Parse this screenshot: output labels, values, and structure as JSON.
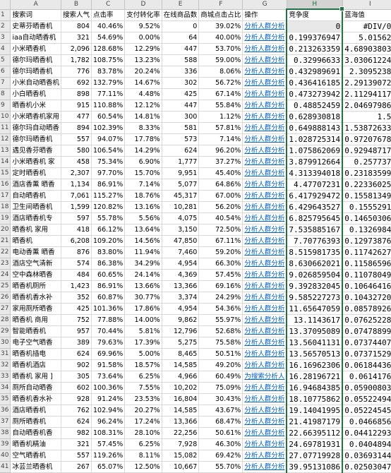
{
  "columns": [
    "",
    "A",
    "B",
    "C",
    "D",
    "E",
    "F",
    "G",
    "H",
    "I"
  ],
  "header": [
    "搜索词",
    "搜索人气",
    "点击率",
    "支付转化率",
    "在线商品数",
    "商城点击占比",
    "操作",
    "竞争度",
    "蓝海值"
  ],
  "rows": [
    {
      "n": "2",
      "a": "史蒂芬晒香机",
      "b": "804",
      "c": "40.46%",
      "d": "9.52%",
      "e": "0",
      "f": "39.02%",
      "g": "分析人群分析",
      "h": "0",
      "i": "#DIV/0!"
    },
    {
      "n": "3",
      "a": "iaa自动晒香机",
      "b": "321",
      "c": "54.69%",
      "d": "0.00%",
      "e": "64",
      "f": "40.00%",
      "g": "分析人群分析",
      "h": "0.199376947",
      "i": "5.015625"
    },
    {
      "n": "4",
      "a": "小米晒香机",
      "b": "2,096",
      "c": "128.68%",
      "d": "12.29%",
      "e": "447",
      "f": "53.70%",
      "g": "分析人群分析",
      "h": "0.213263359",
      "i": "4.689038031"
    },
    {
      "n": "5",
      "a": "德尔玛晒香机",
      "b": "1,782",
      "c": "108.75%",
      "d": "13.23%",
      "e": "588",
      "f": "59.00%",
      "g": "分析人群分析",
      "h": "0.32996633",
      "i": "3.030612245"
    },
    {
      "n": "6",
      "a": "德尔玛晒香机",
      "b": "776",
      "c": "83.78%",
      "d": "20.24%",
      "e": "336",
      "f": "8.06%",
      "g": "分析人群分析",
      "h": "0.432989691",
      "i": "2.30952381"
    },
    {
      "n": "7",
      "a": "小米自动晒香机",
      "b": "692",
      "c": "132.79%",
      "d": "14.67%",
      "e": "302",
      "f": "56.72%",
      "g": "分析人群分析",
      "h": "0.436416185",
      "i": "2.291390728"
    },
    {
      "n": "8",
      "a": "小白晒香机",
      "b": "898",
      "c": "77.11%",
      "d": "4.48%",
      "e": "425",
      "f": "67.14%",
      "g": "分析人群分析",
      "h": "0.473273942",
      "i": "2.112941176"
    },
    {
      "n": "9",
      "a": "晒香机小米",
      "b": "915",
      "c": "110.88%",
      "d": "12.12%",
      "e": "447",
      "f": "55.84%",
      "g": "分析人群分析",
      "h": "0.48852459",
      "i": "2.046979866"
    },
    {
      "n": "10",
      "a": "小米晒香机家用",
      "b": "477",
      "c": "60.54%",
      "d": "14.81%",
      "e": "300",
      "f": "1.12%",
      "g": "分析人群分析",
      "h": "0.628930818",
      "i": "1.59"
    },
    {
      "n": "11",
      "a": "德尔玛自动晒香",
      "b": "894",
      "c": "102.39%",
      "d": "8.33%",
      "e": "581",
      "f": "57.81%",
      "g": "分析人群分析",
      "h": "0.649888143",
      "i": "1.538726334"
    },
    {
      "n": "12",
      "a": "德尔玛晒香机",
      "b": "557",
      "c": "94.07%",
      "d": "17.78%",
      "e": "573",
      "f": "7.14%",
      "g": "分析人群分析",
      "h": "1.028725314",
      "i": "0.972076789"
    },
    {
      "n": "13",
      "a": "遇见香芬晒香",
      "b": "580",
      "c": "106.54%",
      "d": "14.29%",
      "e": "624",
      "f": "96.20%",
      "g": "分析人群分析",
      "h": "1.075862069",
      "i": "0.929487179"
    },
    {
      "n": "14",
      "a": "小米晒香机 家",
      "b": "458",
      "c": "75.34%",
      "d": "6.90%",
      "e": "1,777",
      "f": "37.27%",
      "g": "分析人群分析",
      "h": "3.879912664",
      "i": "0.2577376"
    },
    {
      "n": "15",
      "a": "定时晒香机",
      "b": "2,307",
      "c": "97.70%",
      "d": "15.70%",
      "e": "9,951",
      "f": "45.40%",
      "g": "分析人群分析",
      "h": "4.313394018",
      "i": "0.231835996"
    },
    {
      "n": "16",
      "a": "酒店香薰 晒香",
      "b": "1,134",
      "c": "86.91%",
      "d": "7.14%",
      "e": "5,077",
      "f": "64.86%",
      "g": "分析人群分析",
      "h": "4.47707231",
      "i": "0.223360252"
    },
    {
      "n": "17",
      "a": "自动晒香机",
      "b": "7,061",
      "c": "115.27%",
      "d": "18.76%",
      "e": "45,317",
      "f": "67.00%",
      "g": "分析人群分析",
      "h": "6.417929472",
      "i": "0.155813492"
    },
    {
      "n": "18",
      "a": "卫生间晒香机",
      "b": "1,599",
      "c": "120.82%",
      "d": "13.16%",
      "e": "10,281",
      "f": "56.20%",
      "g": "分析人群分析",
      "h": "6.429643527",
      "i": "0.15552918"
    },
    {
      "n": "19",
      "a": "酒店晒香机专",
      "b": "597",
      "c": "55.78%",
      "d": "5.56%",
      "e": "4,075",
      "f": "40.54%",
      "g": "分析人群分析",
      "h": "6.825795645",
      "i": "0.146503067"
    },
    {
      "n": "20",
      "a": "晒香机 家用",
      "b": "418",
      "c": "66.12%",
      "d": "13.64%",
      "e": "3,150",
      "f": "72.50%",
      "g": "分析人群分析",
      "h": "7.535885167",
      "i": "0.13269841"
    },
    {
      "n": "21",
      "a": "晒香机",
      "b": "6,208",
      "c": "109.20%",
      "d": "14.56%",
      "e": "47,850",
      "f": "67.11%",
      "g": "分析人群分析",
      "h": "7.70776393",
      "i": "0.129738767"
    },
    {
      "n": "22",
      "a": "电动香薰 晒香",
      "b": "876",
      "c": "83.80%",
      "d": "11.94%",
      "e": "7,460",
      "f": "59.20%",
      "g": "分析人群分析",
      "h": "8.515981735",
      "i": "0.117426273"
    },
    {
      "n": "23",
      "a": "酒店空气清新",
      "b": "574",
      "c": "86.38%",
      "d": "34.29%",
      "e": "4,954",
      "f": "66.30%",
      "g": "分析人群分析",
      "h": "8.630662021",
      "i": "0.115865967"
    },
    {
      "n": "24",
      "a": "空中森林晒香",
      "b": "484",
      "c": "60.65%",
      "d": "24.14%",
      "e": "4,369",
      "f": "57.45%",
      "g": "分析人群分析",
      "h": "9.026859504",
      "i": "0.110780499"
    },
    {
      "n": "25",
      "a": "晒香机厕所",
      "b": "1,423",
      "c": "86.91%",
      "d": "13.66%",
      "e": "13,366",
      "f": "69.16%",
      "g": "分析人群分析",
      "h": "9.392832045",
      "i": "0.106464163"
    },
    {
      "n": "26",
      "a": "晒香机香水补",
      "b": "352",
      "c": "60.87%",
      "d": "30.77%",
      "e": "3,374",
      "f": "24.29%",
      "g": "分析人群分析",
      "h": "9.585227273",
      "i": "0.104327208"
    },
    {
      "n": "27",
      "a": "家用厕所晒香",
      "b": "425",
      "c": "101.36%",
      "d": "17.86%",
      "e": "4,954",
      "f": "54.36%",
      "g": "分析人群分析",
      "h": "11.65647059",
      "i": "0.085789261"
    },
    {
      "n": "28",
      "a": "晒香机 商用",
      "b": "752",
      "c": "77.88%",
      "d": "14.00%",
      "e": "9,862",
      "f": "55.97%",
      "g": "分析人群分析",
      "h": "13.1143617",
      "i": "0.076252281"
    },
    {
      "n": "29",
      "a": "智能晒香机",
      "b": "957",
      "c": "70.44%",
      "d": "5.81%",
      "e": "12,796",
      "f": "52.68%",
      "g": "分析人群分析",
      "h": "13.37095089",
      "i": "0.074788997"
    },
    {
      "n": "30",
      "a": "电子空气晒香",
      "b": "389",
      "c": "79.63%",
      "d": "17.39%",
      "e": "5,275",
      "f": "75.58%",
      "g": "分析人群分析",
      "h": "13.56041131",
      "i": "0.073744076"
    },
    {
      "n": "31",
      "a": "晒香机插电",
      "b": "624",
      "c": "69.96%",
      "d": "5.00%",
      "e": "8,465",
      "f": "50.51%",
      "g": "分析人群分析",
      "h": "13.56570513",
      "i": "0.073715298"
    },
    {
      "n": "32",
      "a": "晒香机酒店",
      "b": "902",
      "c": "91.58%",
      "d": "18.57%",
      "e": "14,585",
      "f": "49.20%",
      "g": "分析人群分析",
      "h": "16.16962306",
      "i": "0.061844361"
    },
    {
      "n": "33",
      "a": "晒香机 家用 ]",
      "b": "305",
      "c": "73.64%",
      "d": "6.25%",
      "e": "4,966",
      "f": "60.49%",
      "g": "为搜索分析人",
      "h": "16.28196721",
      "i": "0.06141764"
    },
    {
      "n": "34",
      "a": "厕所自动晒香",
      "b": "602",
      "c": "100.36%",
      "d": "7.55%",
      "e": "10,202",
      "f": "75.09%",
      "g": "分析人群分析",
      "h": "16.94684385",
      "i": "0.059008038"
    },
    {
      "n": "35",
      "a": "晒香机香水补",
      "b": "928",
      "c": "91.24%",
      "d": "23.53%",
      "e": "16,804",
      "f": "30.43%",
      "g": "分析人群分析",
      "h": "18.10775862",
      "i": "0.055224946"
    },
    {
      "n": "36",
      "a": "酒店晒香机",
      "b": "762",
      "c": "102.94%",
      "d": "20.27%",
      "e": "14,585",
      "f": "43.67%",
      "g": "分析人群分析",
      "h": "19.14041995",
      "i": "0.052245458"
    },
    {
      "n": "37",
      "a": "厕所晒香机",
      "b": "624",
      "c": "96.24%",
      "d": "17.24%",
      "e": "13,366",
      "f": "68.47%",
      "g": "分析人群分析",
      "h": "21.41987179",
      "i": "0.04668562"
    },
    {
      "n": "38",
      "a": "自动晒香机香",
      "b": "982",
      "c": "108.31%",
      "d": "28.10%",
      "e": "22,256",
      "f": "50.61%",
      "g": "分析人群分析",
      "h": "22.66395112",
      "i": "0.044122933"
    },
    {
      "n": "39",
      "a": "晒香机精油",
      "b": "321",
      "c": "57.45%",
      "d": "6.25%",
      "e": "7,928",
      "f": "46.30%",
      "g": "分析人群分析",
      "h": "24.69781931",
      "i": "0.04048945"
    },
    {
      "n": "40",
      "a": "空气晒香机",
      "b": "557",
      "c": "119.26%",
      "d": "8.11%",
      "e": "15,082",
      "f": "69.42%",
      "g": "分析人群分析",
      "h": "27.07719928",
      "i": "0.036931441"
    },
    {
      "n": "41",
      "a": "冰芸兰晒香机",
      "b": "267",
      "c": "65.07%",
      "d": "12.50%",
      "e": "10,667",
      "f": "55.70%",
      "g": "分析人群分析",
      "h": "39.95131086",
      "i": "0.025030477"
    }
  ],
  "colors": {
    "accent": "#217346",
    "link": "#0563c1",
    "header_bg": "#e9e9e9"
  }
}
